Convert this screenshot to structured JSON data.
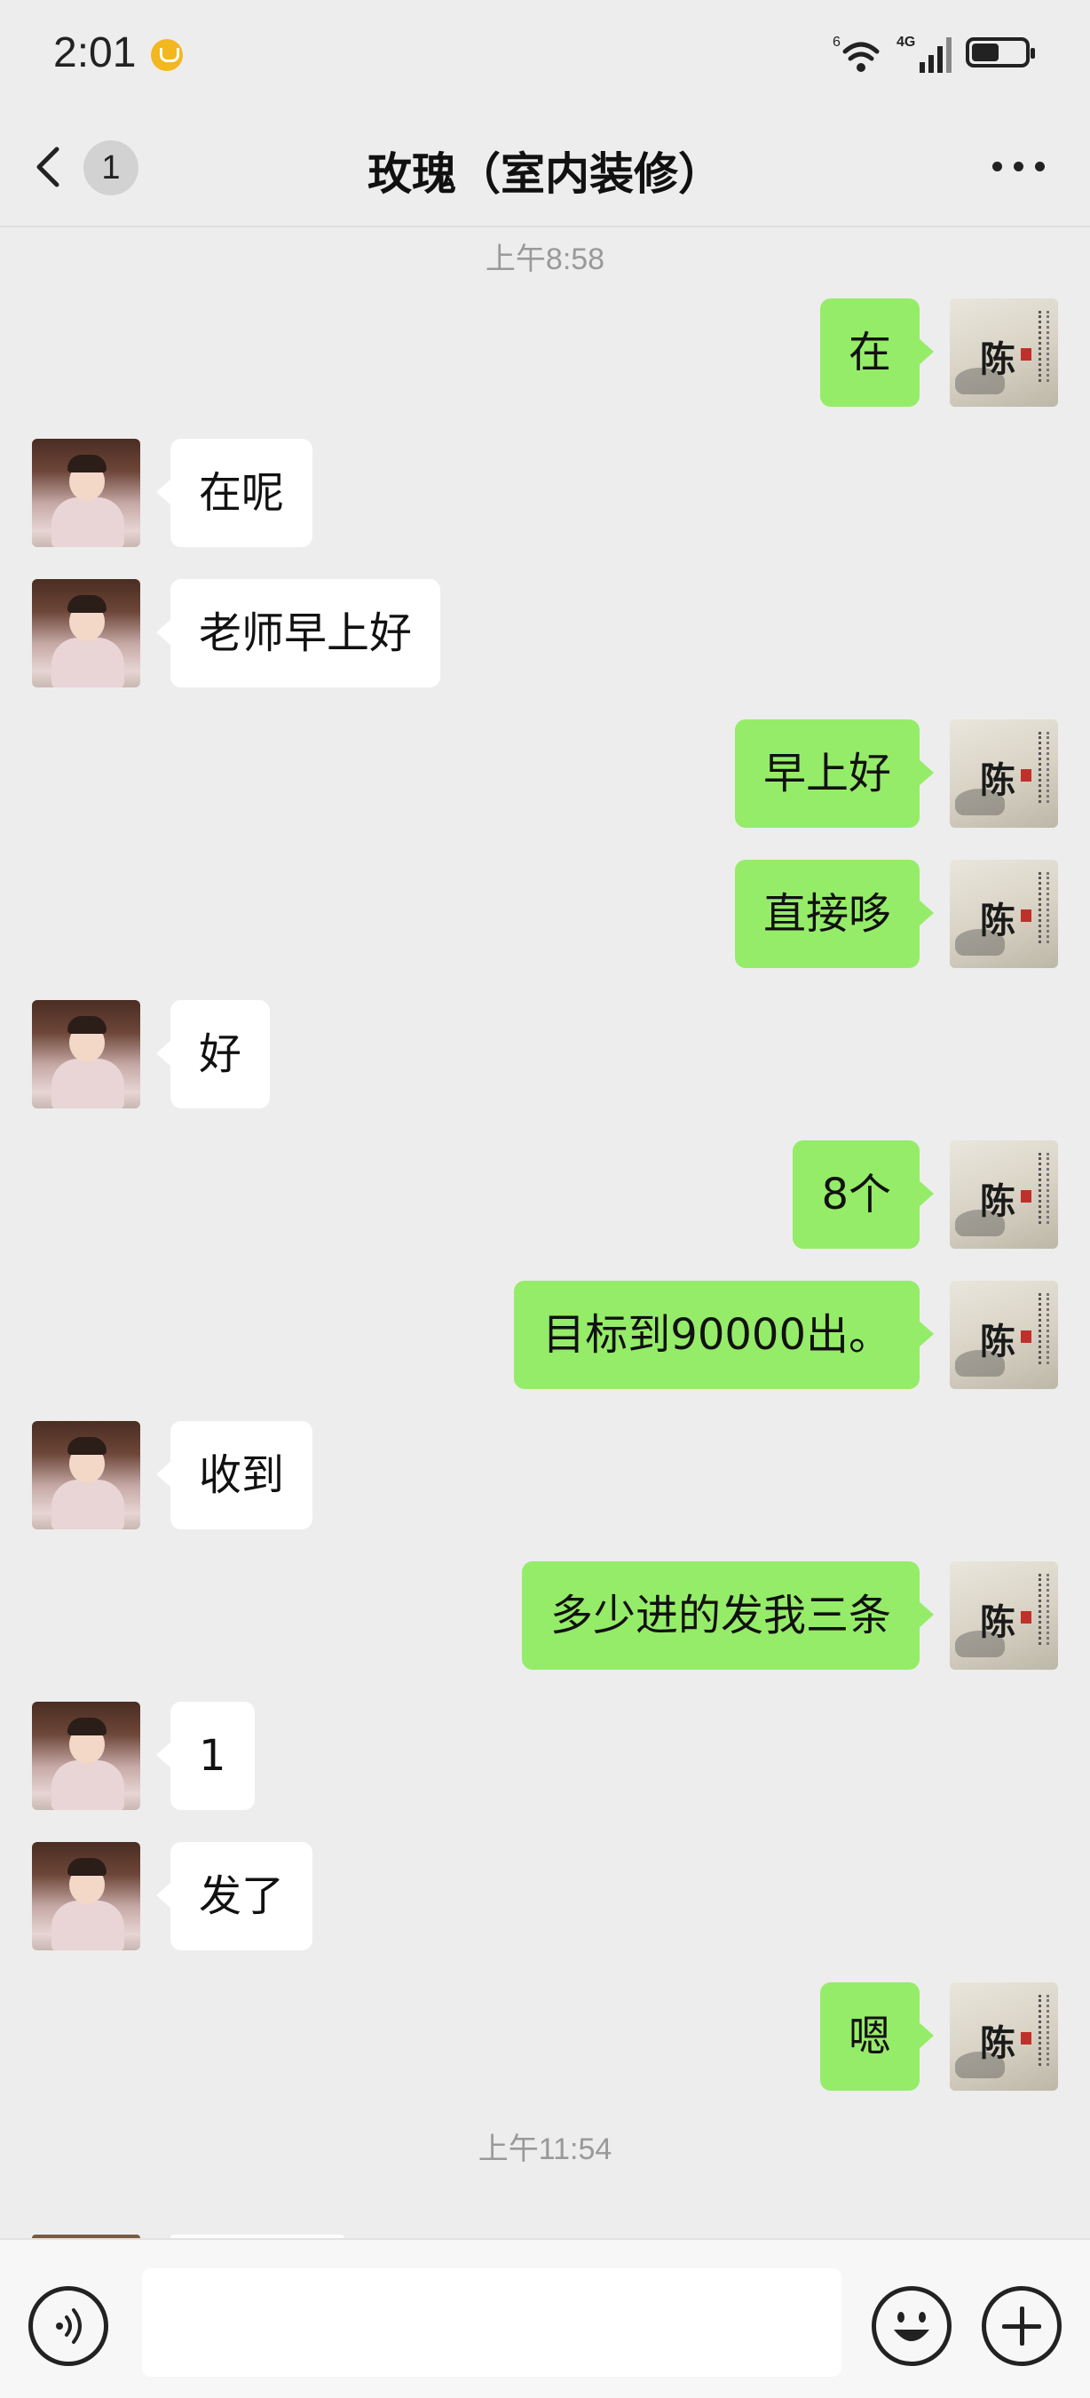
{
  "status_bar": {
    "time": "2:01",
    "network_label": "4G",
    "wifi_label": "6",
    "icons": [
      "coin-notification-icon",
      "wifi-icon",
      "cellular-signal-icon",
      "battery-icon"
    ]
  },
  "header": {
    "back_icon": "chevron-left-icon",
    "unread_count": "1",
    "title": "玫瑰（室内装修）",
    "more_icon": "more-dots-icon"
  },
  "messages": [
    {
      "type": "time",
      "text": "上午8:58"
    },
    {
      "type": "msg",
      "side": "right",
      "text": "在"
    },
    {
      "type": "msg",
      "side": "left",
      "text": "在呢"
    },
    {
      "type": "msg",
      "side": "left",
      "text": "老师早上好"
    },
    {
      "type": "msg",
      "side": "right",
      "text": "早上好"
    },
    {
      "type": "msg",
      "side": "right",
      "text": "直接哆"
    },
    {
      "type": "msg",
      "side": "left",
      "text": "好"
    },
    {
      "type": "msg",
      "side": "right",
      "text": "8个"
    },
    {
      "type": "msg",
      "side": "right",
      "text": "目标到90000出。"
    },
    {
      "type": "msg",
      "side": "left",
      "text": "收到"
    },
    {
      "type": "msg",
      "side": "right",
      "text": "多少进的发我三条"
    },
    {
      "type": "msg",
      "side": "left",
      "text": "1"
    },
    {
      "type": "msg",
      "side": "left",
      "text": "发了"
    },
    {
      "type": "msg",
      "side": "right",
      "text": "嗯"
    },
    {
      "type": "time",
      "text": "上午11:54"
    }
  ],
  "avatars": {
    "self_char": "陈"
  },
  "input_bar": {
    "value": "",
    "icons": [
      "voice-icon",
      "emoji-icon",
      "plus-icon"
    ]
  },
  "colors": {
    "background": "#ededed",
    "self_bubble": "#95ec69",
    "other_bubble": "#ffffff",
    "timestamp": "#999999"
  }
}
